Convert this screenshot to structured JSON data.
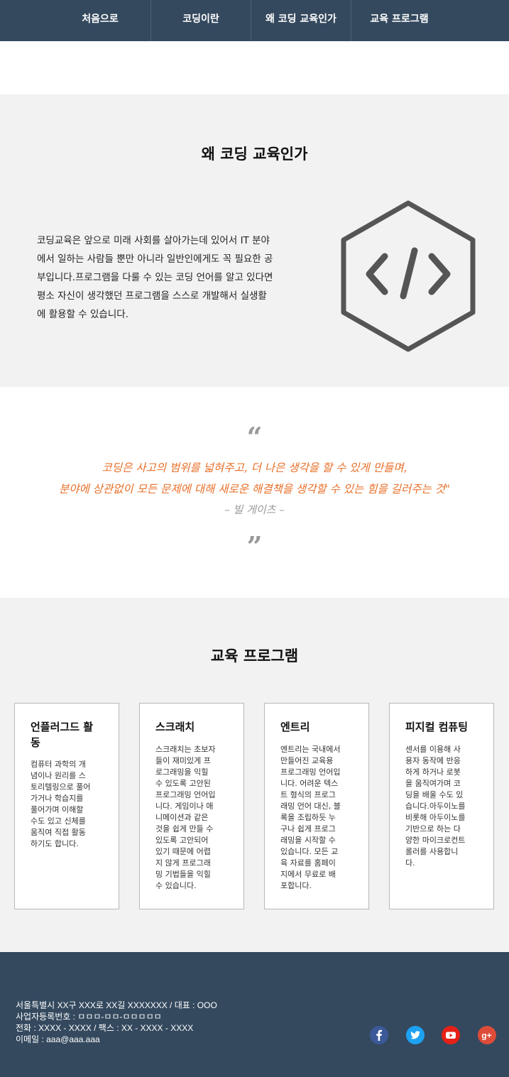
{
  "nav": {
    "items": [
      {
        "label": "처음으로"
      },
      {
        "label": "코딩이란"
      },
      {
        "label": "왜 코딩 교육인가"
      },
      {
        "label": "교육 프로그램"
      }
    ]
  },
  "why": {
    "title": "왜 코딩 교육인가",
    "lines": [
      "코딩교육은 앞으로 미래 사회를 살아가는데 있어서 IT 분야",
      "에서 일하는 사람들 뿐만 아니라 일반인에게도 꼭 필요한 공",
      "부입니다.프로그램을 다룰 수 있는 코딩 언어를 알고 있다면",
      "평소 자신이 생각했던 프로그램을 스스로 개발해서 실생활",
      "에 활용할 수 있습니다."
    ],
    "icon": "code-hexagon-icon"
  },
  "quote": {
    "open_mark": "“",
    "line1": "코딩은 사고의 범위를 넓혀주고, 더 나은 생각을 할 수 있게 만들며,",
    "line2": "분야에 상관없이 모든 문제에 대해 새로운 해결책을 생각할 수 있는 힘을 길러주는 것\"",
    "author": "– 빌 게이츠 –",
    "close_mark": "”"
  },
  "programs": {
    "title": "교육 프로그램",
    "cards": [
      {
        "title": "언플러그드 활동",
        "title_lines": [
          "언플러그드 활",
          "동"
        ],
        "desc_lines": [
          "컴퓨터 과학의 개",
          "념이나 원리를 스",
          "토리텔링으로 풀어",
          "가거나 학습지를",
          "풀어가며 이해할",
          "수도 있고 신체를",
          "움직여 직접 활동",
          "하기도 합니다."
        ]
      },
      {
        "title": "스크래치",
        "title_lines": [
          "스크래치"
        ],
        "desc_lines": [
          "스크래치는 초보자",
          "들이 재미있게 프",
          "로그래밍을 익힐",
          "수 있도록 고안된",
          "프로그래밍 언어입",
          "니다. 게임이나 애",
          "니메이션과 같은",
          "것을 쉽게 만들 수",
          "있도록 고안되어",
          "있기 때문에 어렵",
          "지 않게 프로그래",
          "밍 기법들을 익힐",
          "수 있습니다."
        ]
      },
      {
        "title": "엔트리",
        "title_lines": [
          "엔트리"
        ],
        "desc_lines": [
          "엔트리는 국내에서",
          "만들어진 교육용",
          "프로그래밍 언어입",
          "니다. 어려운 텍스",
          "트 형식의 프로그",
          "래밍 언어 대신, 블",
          "록을 조립하듯 누",
          "구나 쉽게 프로그",
          "래밍을 시작할 수",
          "있습니다. 모든 교",
          "육 자료를 홈페이",
          "지에서 무료로 배",
          "포합니다."
        ]
      },
      {
        "title": "피지컬 컴퓨팅",
        "title_lines": [
          "피지컬 컴퓨팅"
        ],
        "desc_lines": [
          "센서를 이용해 사",
          "용자 동작에 반응",
          "하게 하거나 로봇",
          "을 움직여가며 코",
          "딩을 배울 수도 있",
          "습니다.아두이노를",
          "비롯해 아두이노를",
          "기반으로 하는 다",
          "양한 마이크로컨트",
          "롤러를 사용합니",
          "다."
        ]
      }
    ]
  },
  "footer": {
    "lines": [
      "서울특별시 XX구 XXX로 XX길 XXXXXXX / 대표 : OOO",
      "사업자등록번호 : ㅁㅁㅁ-ㅁㅁ-ㅁㅁㅁㅁㅁ",
      "전화 : XXXX - XXXX / 팩스 : XX - XXXX - XXXX",
      "이메일 : aaa@aaa.aaa"
    ],
    "social": [
      {
        "icon": "facebook-icon",
        "color": "#3b5998",
        "glyph": "f"
      },
      {
        "icon": "twitter-icon",
        "color": "#1da1f2",
        "glyph": ""
      },
      {
        "icon": "youtube-icon",
        "color": "#e62117",
        "glyph": ""
      },
      {
        "icon": "google-plus-icon",
        "color": "#dd4b39",
        "glyph": "g+"
      }
    ]
  },
  "colors": {
    "nav_bg": "#34495e",
    "section_bg": "#f2f2f2",
    "quote_accent": "#e8702a",
    "quote_mark": "#9a9a9a"
  }
}
